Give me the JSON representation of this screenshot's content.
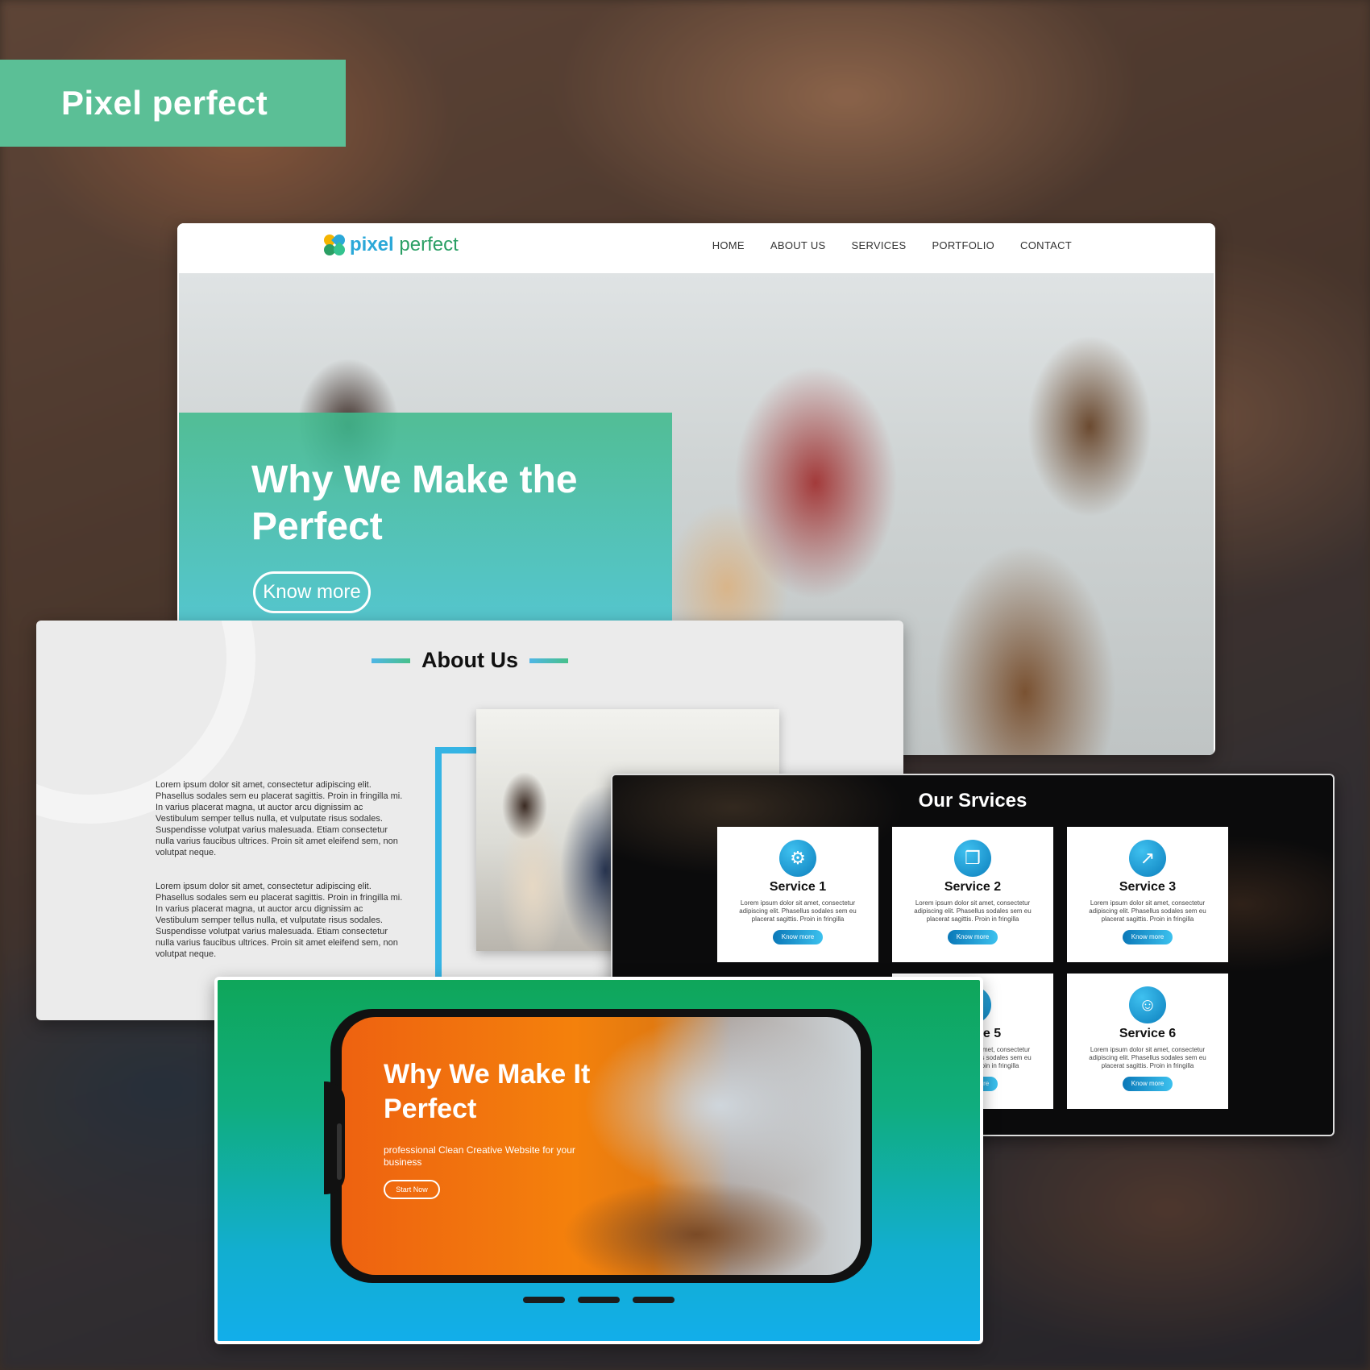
{
  "badge": {
    "label": "Pixel perfect"
  },
  "website": {
    "logo": {
      "brand": "pixel",
      "suffix": "perfect",
      "colors": [
        "#f4b400",
        "#2ba8d8",
        "#2a9f64",
        "#34c38f"
      ]
    },
    "nav": [
      "HOME",
      "ABOUT US",
      "SERVICES",
      "PORTFOLIO",
      "CONTACT"
    ],
    "hero": {
      "title": "Why We Make the Perfect",
      "button": "Know more"
    }
  },
  "about": {
    "title": "About Us",
    "paragraphs": [
      "Lorem ipsum dolor sit amet, consectetur adipiscing elit. Phasellus sodales sem eu placerat sagittis. Proin in fringilla mi. In varius placerat magna, ut auctor arcu dignissim ac Vestibulum semper tellus nulla, et vulputate risus sodales. Suspendisse volutpat varius malesuada. Etiam consectetur nulla varius faucibus ultrices. Proin sit amet eleifend sem, non volutpat neque.",
      "Lorem ipsum dolor sit amet, consectetur adipiscing elit. Phasellus sodales sem eu placerat sagittis. Proin in fringilla mi. In varius placerat magna, ut auctor arcu dignissim ac Vestibulum semper tellus nulla, et vulputate risus sodales. Suspendisse volutpat varius malesuada. Etiam consectetur nulla varius faucibus ultrices. Proin sit amet eleifend sem, non volutpat neque."
    ]
  },
  "services": {
    "title": "Our Srvices",
    "description": "Lorem ipsum dolor sit amet, consectetur adipiscing elit. Phasellus sodales sem eu placerat sagittis. Proin in fringilla",
    "button": "Know more",
    "items": [
      {
        "name": "Service 1",
        "icon": "gears-icon"
      },
      {
        "name": "Service 2",
        "icon": "cubes-icon"
      },
      {
        "name": "Service 3",
        "icon": "chart-icon"
      },
      {
        "name": "Service 5",
        "icon": "globe-icon"
      },
      {
        "name": "Service 6",
        "icon": "user-icon"
      }
    ]
  },
  "mobile": {
    "title": "Why We Make It Perfect",
    "subtitle": "professional Clean Creative Website for your business",
    "button": "Start Now"
  }
}
